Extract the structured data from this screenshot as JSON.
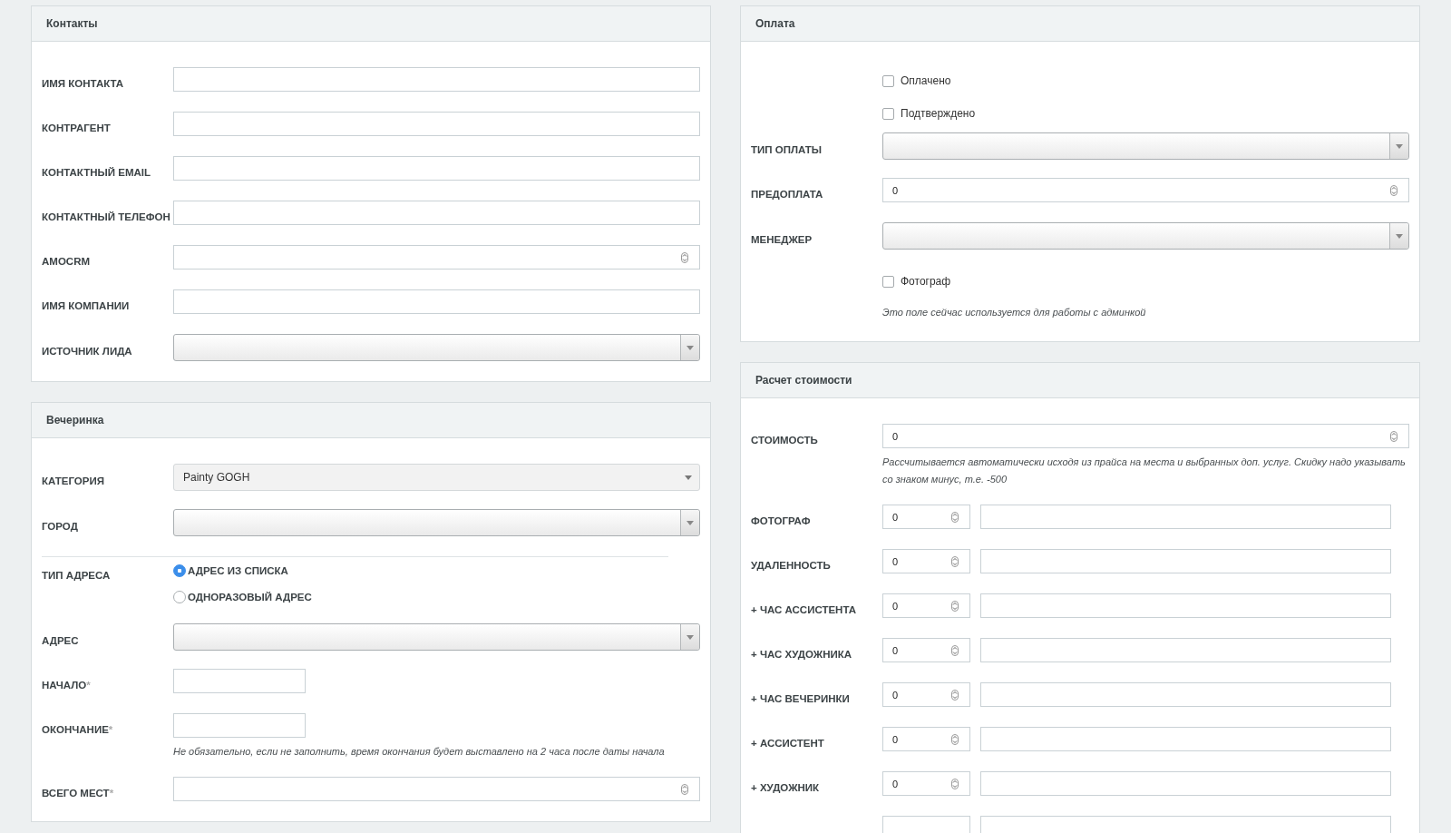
{
  "columns": [
    {
      "panels": [
        {
          "title": "Контакты",
          "rows": [
            {
              "kind": "text",
              "label": "ИМЯ КОНТАКТА"
            },
            {
              "kind": "text",
              "label": "КОНТРАГЕНТ"
            },
            {
              "kind": "text",
              "label": "КОНТАКТНЫЙ EMAIL"
            },
            {
              "kind": "text",
              "label": "КОНТАКТНЫЙ ТЕЛЕФОН"
            },
            {
              "kind": "number",
              "label": "AMOCRM"
            },
            {
              "kind": "text",
              "label": "ИМЯ КОМПАНИИ"
            },
            {
              "kind": "select",
              "label": "ИСТОЧНИК ЛИДА",
              "disabled": false
            }
          ]
        },
        {
          "title": "Вечеринка",
          "rows": [
            {
              "kind": "select",
              "label": "КАТЕГОРИЯ",
              "value": "Painty GOGH",
              "disabled": true
            },
            {
              "kind": "select",
              "label": "ГОРОД",
              "disabled": false
            },
            {
              "kind": "radio",
              "label": "ТИП АДРЕСА",
              "options": [
                {
                  "label": "АДРЕС ИЗ СПИСКА",
                  "selected": true
                },
                {
                  "label": "ОДНОРАЗОВЫЙ АДРЕС",
                  "selected": false
                }
              ]
            },
            {
              "kind": "select",
              "label": "АДРЕС",
              "disabled": false
            },
            {
              "kind": "short",
              "label": "НАЧАЛО",
              "required_mark": "*"
            },
            {
              "kind": "short",
              "label": "ОКОНЧАНИЕ",
              "required_mark": "*",
              "hint": "Не обязательно, если не заполнить, время окончания будет выставлено на 2 часа после даты начала"
            },
            {
              "kind": "number",
              "label": "ВСЕГО МЕСТ",
              "required_mark": "*"
            }
          ]
        }
      ]
    },
    {
      "panels": [
        {
          "title": "Оплата",
          "rows": [
            {
              "kind": "checkbox",
              "label": "Оплачено",
              "checked": false
            },
            {
              "kind": "checkbox",
              "label": "Подтверждено",
              "checked": false
            },
            {
              "kind": "select",
              "label": "ТИП ОПЛАТЫ",
              "disabled": false
            },
            {
              "kind": "number",
              "label": "ПРЕДОПЛАТА",
              "value": "0"
            },
            {
              "kind": "select",
              "label": "МЕНЕДЖЕР",
              "disabled": false
            },
            {
              "kind": "checkbox",
              "label": "Фотограф",
              "checked": false,
              "hint": "Это поле сейчас используется для работы с админкой"
            }
          ]
        },
        {
          "title": "Расчет стоимости",
          "rows": [
            {
              "kind": "number",
              "label": "СТОИМОСТЬ",
              "value": "0",
              "hint": "Рассчитывается автоматически исходя из прайса на места и выбранных доп. услуг. Скидку надо указывать со знаком минус, т.е. -500"
            },
            {
              "kind": "pair",
              "label": "ФОТОГРАФ",
              "value": "0"
            },
            {
              "kind": "pair",
              "label": "УДАЛЕННОСТЬ",
              "value": "0"
            },
            {
              "kind": "pair",
              "label": "+ ЧАС АССИСТЕНТА",
              "value": "0"
            },
            {
              "kind": "pair",
              "label": "+ ЧАС ХУДОЖНИКА",
              "value": "0"
            },
            {
              "kind": "pair",
              "label": "+ ЧАС ВЕЧЕРИНКИ",
              "value": "0"
            },
            {
              "kind": "pair",
              "label": "+ АССИСТЕНТ",
              "value": "0"
            },
            {
              "kind": "pair",
              "label": "+ ХУДОЖНИК",
              "value": "0"
            },
            {
              "kind": "pair-cut"
            }
          ]
        }
      ]
    }
  ]
}
